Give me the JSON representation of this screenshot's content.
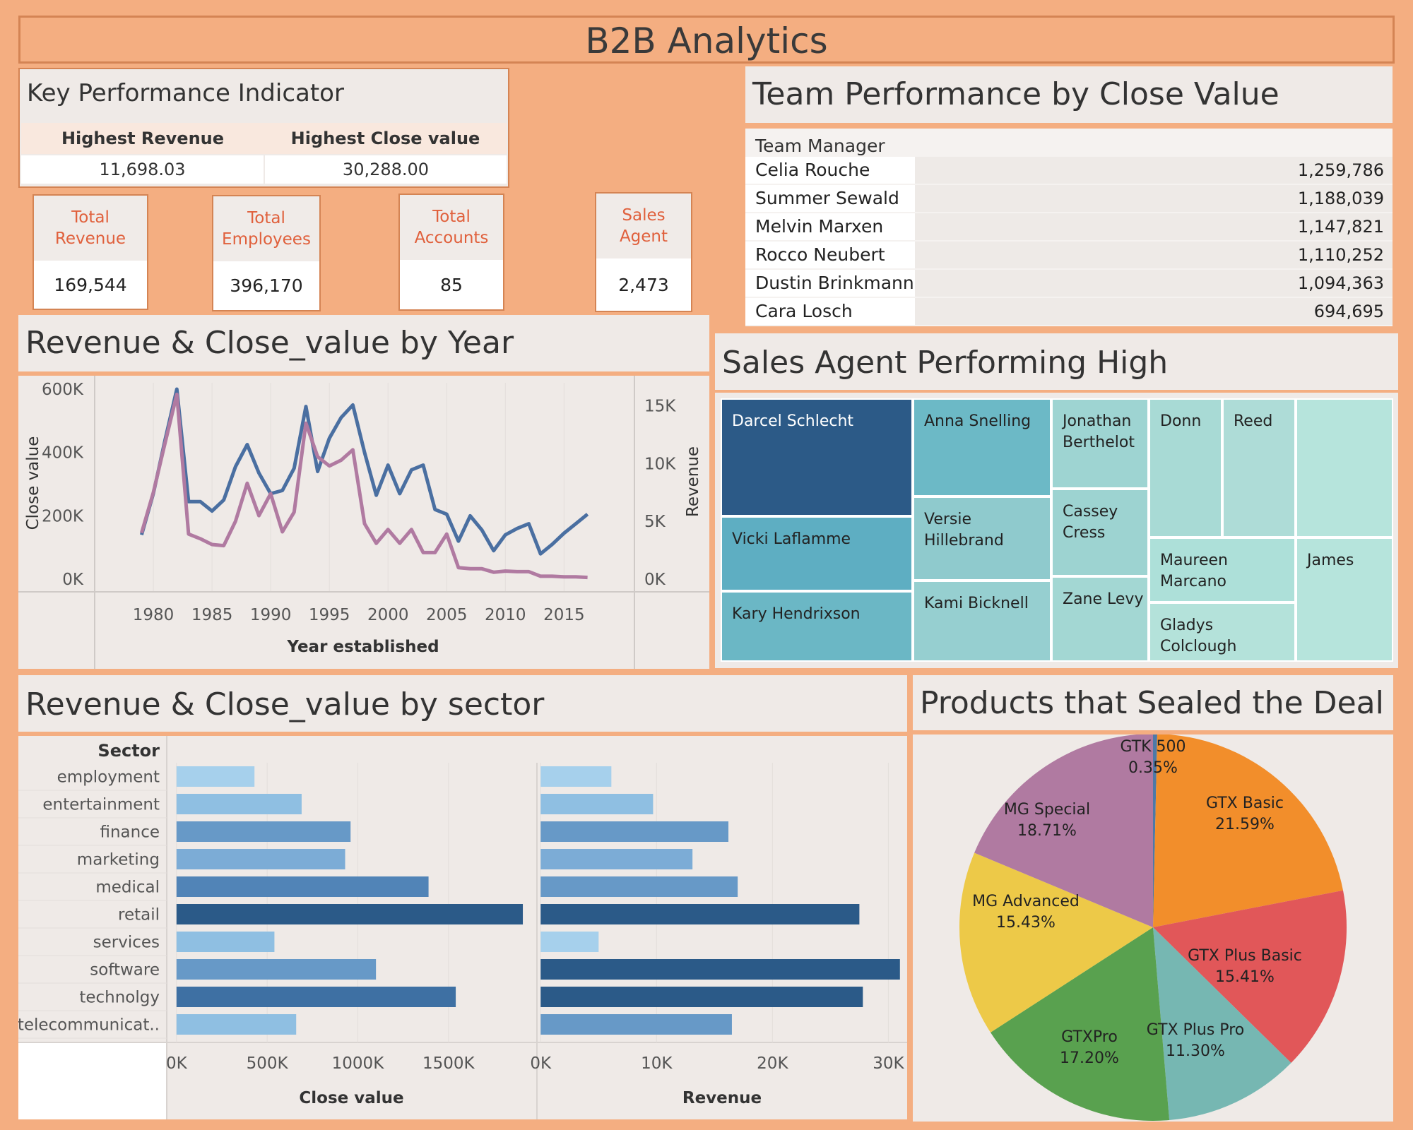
{
  "header": {
    "title": "B2B Analytics"
  },
  "kpi": {
    "title": "Key Performance Indicator",
    "columns": [
      {
        "label": "Highest Revenue",
        "value": "11,698.03"
      },
      {
        "label": "Highest Close value",
        "value": "30,288.00"
      }
    ]
  },
  "cards": [
    {
      "label": "Total Revenue",
      "value": "169,544"
    },
    {
      "label": "Total Employees",
      "value": "396,170"
    },
    {
      "label": "Total Accounts",
      "value": "85"
    },
    {
      "label": "Sales Agent",
      "value": "2,473"
    }
  ],
  "team": {
    "title": "Team Performance by Close Value",
    "header": "Team Manager",
    "rows": [
      {
        "name": "Celia Rouche",
        "value": "1,259,786"
      },
      {
        "name": "Summer Sewald",
        "value": "1,188,039"
      },
      {
        "name": "Melvin Marxen",
        "value": "1,147,821"
      },
      {
        "name": "Rocco Neubert",
        "value": "1,110,252"
      },
      {
        "name": "Dustin Brinkmann",
        "value": "1,094,363"
      },
      {
        "name": "Cara Losch",
        "value": "694,695"
      }
    ]
  },
  "year_panel": {
    "title": "Revenue & Close_value by Year"
  },
  "treemap": {
    "title": "Sales Agent Performing High",
    "agents": [
      "Darcel Schlecht",
      "Vicki Laflamme",
      "Kary Hendrixson",
      "Anna Snelling",
      "Versie Hillebrand",
      "Kami Bicknell",
      "Jonathan Berthelot",
      "Cassey Cress",
      "Zane Levy",
      "Donn",
      "Reed",
      "Maureen Marcano",
      "Gladys Colclough",
      "James"
    ],
    "colors": [
      "#2c5a87",
      "#5eaec2",
      "#6bb7c5",
      "#6cb9c6",
      "#8fcacd",
      "#96cfd0",
      "#9ed4d2",
      "#9dd3d1",
      "#a3d7d3",
      "#a8dad5",
      "#aedcd7",
      "#ade0d9",
      "#b4e2da",
      "#b6e4dc"
    ]
  },
  "sector_panel": {
    "title": "Revenue & Close_value by sector"
  },
  "pie_panel": {
    "title": "Products that Sealed the Deal"
  },
  "chart_data": [
    {
      "type": "line",
      "title": "Revenue & Close_value by Year",
      "xlabel": "Year established",
      "ylabel": "Close value",
      "y2label": "Revenue",
      "xlim": [
        1975,
        2021
      ],
      "xticks": [
        1980,
        1985,
        1990,
        1995,
        2000,
        2005,
        2010,
        2015
      ],
      "ylim": [
        -40000,
        620000
      ],
      "yticks": [
        0,
        200000,
        400000,
        600000
      ],
      "yticklabels": [
        "0K",
        "200K",
        "400K",
        "600K"
      ],
      "y2lim": [
        -1100,
        17000
      ],
      "y2ticks": [
        0,
        5000,
        10000,
        15000
      ],
      "y2ticklabels": [
        "0K",
        "5K",
        "10K",
        "15K"
      ],
      "series": [
        {
          "axis": "left",
          "color": "#4a6fa1",
          "x": [
            1979,
            1980,
            1981,
            1982,
            1983,
            1984,
            1985,
            1986,
            1987,
            1988,
            1989,
            1990,
            1991,
            1992,
            1993,
            1994,
            1995,
            1996,
            1997,
            1998,
            1999,
            2000,
            2001,
            2002,
            2003,
            2004,
            2005,
            2006,
            2007,
            2008,
            2009,
            2010,
            2011,
            2012,
            2013,
            2014,
            2015,
            2016,
            2017
          ],
          "values": [
            140000,
            270000,
            440000,
            600000,
            245000,
            245000,
            215000,
            250000,
            355000,
            425000,
            335000,
            270000,
            280000,
            350000,
            545000,
            340000,
            445000,
            510000,
            550000,
            400000,
            265000,
            360000,
            270000,
            345000,
            360000,
            220000,
            205000,
            120000,
            200000,
            155000,
            90000,
            140000,
            160000,
            175000,
            80000,
            110000,
            145000,
            175000,
            205000
          ]
        },
        {
          "axis": "right",
          "color": "#b07aa1",
          "x": [
            1979,
            1980,
            1981,
            1982,
            1983,
            1984,
            1985,
            1986,
            1987,
            1988,
            1989,
            1990,
            1991,
            1992,
            1993,
            1994,
            1995,
            1996,
            1997,
            1998,
            1999,
            2000,
            2001,
            2002,
            2003,
            2004,
            2005,
            2006,
            2007,
            2008,
            2009,
            2010,
            2011,
            2012,
            2013,
            2014,
            2015,
            2016,
            2017
          ],
          "values": [
            4000,
            7500,
            11800,
            16000,
            3900,
            3500,
            3000,
            2900,
            5000,
            8300,
            5500,
            7400,
            4100,
            5800,
            13500,
            10600,
            9800,
            10300,
            11200,
            4800,
            3100,
            4300,
            3100,
            4300,
            2300,
            2300,
            3900,
            1000,
            900,
            900,
            600,
            700,
            650,
            650,
            250,
            250,
            200,
            200,
            150
          ]
        }
      ]
    },
    {
      "type": "bar",
      "title": "Revenue & Close_value by sector",
      "ylabel": "Sector",
      "categories": [
        "employment",
        "entertainment",
        "finance",
        "marketing",
        "medical",
        "retail",
        "services",
        "software",
        "technolgy",
        "telecommunicat.."
      ],
      "category_labels": [
        "employment",
        "entertainment",
        "finance",
        "marketing",
        "medical",
        "retail",
        "services",
        "software",
        "technolgy",
        "telecommunicat.."
      ],
      "series": [
        {
          "xlabel": "Close value",
          "values": [
            430000,
            690000,
            960000,
            930000,
            1390000,
            1910000,
            540000,
            1100000,
            1540000,
            660000
          ],
          "xlim": [
            -50000,
            1980000
          ],
          "xticks": [
            0,
            500000,
            1000000,
            1500000
          ],
          "xticklabels": [
            "0K",
            "500K",
            "1000K",
            "1500K"
          ]
        },
        {
          "xlabel": "Revenue",
          "values": [
            6100,
            9700,
            16200,
            13100,
            17000,
            27500,
            5000,
            31000,
            27800,
            16500
          ],
          "xlim": [
            -200,
            31500
          ],
          "xticks": [
            0,
            10000,
            20000,
            30000
          ],
          "xticklabels": [
            "0K",
            "10K",
            "20K",
            "30K"
          ]
        }
      ]
    },
    {
      "type": "pie",
      "title": "Products that Sealed the Deal",
      "slices": [
        {
          "label": "GTK 500",
          "value": 0.35,
          "display": "0.35%",
          "color": "#4e79a7"
        },
        {
          "label": "GTX Basic",
          "value": 21.59,
          "display": "21.59%",
          "color": "#f28e2b"
        },
        {
          "label": "GTX Plus Basic",
          "value": 15.41,
          "display": "15.41%",
          "color": "#e15759"
        },
        {
          "label": "GTX Plus Pro",
          "value": 11.3,
          "display": "11.30%",
          "color": "#76b7b2"
        },
        {
          "label": "GTXPro",
          "value": 17.2,
          "display": "17.20%",
          "color": "#59a14f"
        },
        {
          "label": "MG Advanced",
          "value": 15.43,
          "display": "15.43%",
          "color": "#edc948"
        },
        {
          "label": "MG Special",
          "value": 18.71,
          "display": "18.71%",
          "color": "#b07aa1"
        }
      ]
    }
  ]
}
